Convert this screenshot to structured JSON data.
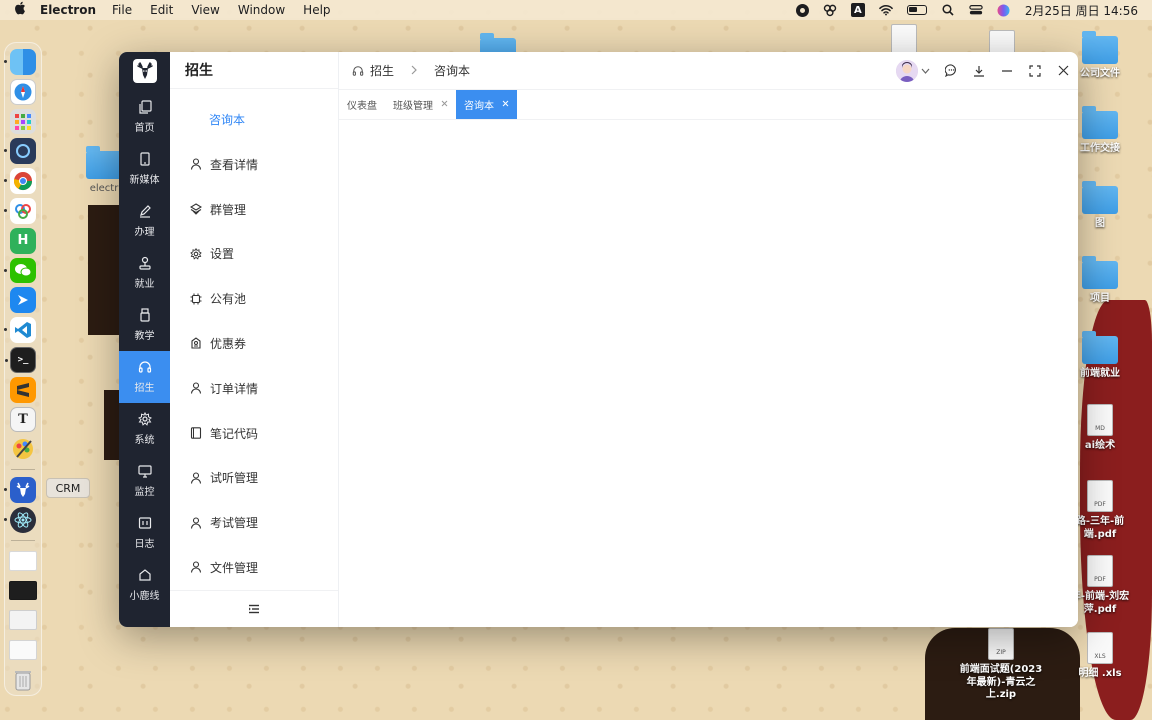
{
  "menubar": {
    "app_name": "Electron",
    "menus": [
      "File",
      "Edit",
      "View",
      "Window",
      "Help"
    ],
    "input_indicator": "A",
    "clock": "2月25日 周日 14:56"
  },
  "dock": {
    "tooltip": "CRM",
    "text_app_glyph": "T",
    "hbuilder_glyph": "H"
  },
  "desktop_icons": [
    {
      "label": "公司文件"
    },
    {
      "label": "工作交接"
    },
    {
      "label": "图"
    },
    {
      "label": "项目"
    },
    {
      "label": "前端就业"
    },
    {
      "label": "ai绘术",
      "doc_mark": "MD"
    },
    {
      "label": "路-三年-前端.pdf",
      "doc_mark": "PDF"
    },
    {
      "label": "年-前端-刘宏萍.pdf",
      "doc_mark": "PDF"
    },
    {
      "label": "前端面试题(2023年最新)-青云之上.zip",
      "doc_mark": "ZIP"
    },
    {
      "label": "明细 .xls",
      "doc_mark": "XLS"
    },
    {
      "label": "electr"
    }
  ],
  "nav": {
    "items": [
      {
        "label": "首页",
        "icon": "copy-icon"
      },
      {
        "label": "新媒体",
        "icon": "tablet-icon"
      },
      {
        "label": "办理",
        "icon": "pen-icon"
      },
      {
        "label": "就业",
        "icon": "joystick-icon"
      },
      {
        "label": "教学",
        "icon": "usb-icon"
      },
      {
        "label": "招生",
        "icon": "headset-icon",
        "active": true
      },
      {
        "label": "系统",
        "icon": "gear-icon"
      },
      {
        "label": "监控",
        "icon": "monitor-icon"
      },
      {
        "label": "日志",
        "icon": "log-icon"
      },
      {
        "label": "小鹿线",
        "icon": "home-icon"
      }
    ]
  },
  "submenu": {
    "title": "招生",
    "items": [
      {
        "label": "咨询本",
        "active": true
      },
      {
        "label": "查看详情",
        "icon": "user-icon"
      },
      {
        "label": "群管理",
        "icon": "group-icon"
      },
      {
        "label": "设置",
        "icon": "gear-icon"
      },
      {
        "label": "公有池",
        "icon": "chip-icon"
      },
      {
        "label": "优惠券",
        "icon": "coupon-icon"
      },
      {
        "label": "订单详情",
        "icon": "user-icon"
      },
      {
        "label": "笔记代码",
        "icon": "notebook-icon"
      },
      {
        "label": "试听管理",
        "icon": "user-icon"
      },
      {
        "label": "考试管理",
        "icon": "user-icon"
      },
      {
        "label": "文件管理",
        "icon": "user-icon"
      }
    ]
  },
  "topbar": {
    "breadcrumb": [
      "招生",
      "咨询本"
    ]
  },
  "tabs": [
    {
      "label": "仪表盘",
      "closable": false
    },
    {
      "label": "班级管理",
      "closable": true
    },
    {
      "label": "咨询本",
      "closable": true,
      "active": true
    }
  ],
  "colors": {
    "nav_bg": "#1f2430",
    "accent": "#3b8ef0",
    "active_text": "#2f86f6"
  }
}
